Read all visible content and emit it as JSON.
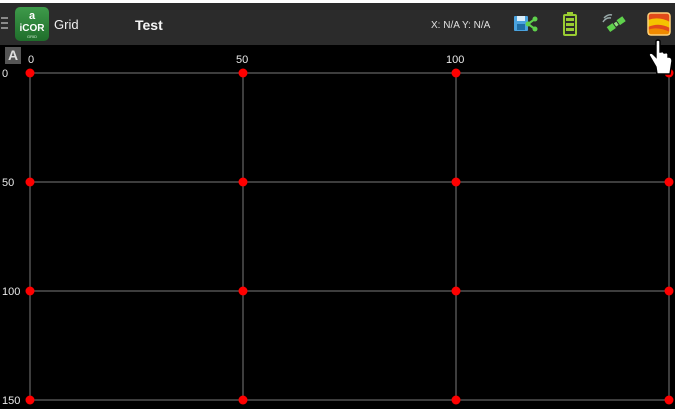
{
  "toolbar": {
    "menu_icon": "hamburger-menu-icon",
    "logo": {
      "mark": "a",
      "brand": "iCOR",
      "sub": "GRID"
    },
    "app_title": "Grid",
    "document_title": "Test",
    "coords_readout": "X: N/A Y: N/A",
    "icons": [
      "save-network-icon",
      "battery-icon",
      "satellite-icon",
      "heatmap-icon"
    ]
  },
  "grid": {
    "corner_label": "A",
    "x_ticks": [
      "0",
      "50",
      "100"
    ],
    "y_ticks": [
      "0",
      "50",
      "100",
      "150"
    ],
    "x_values": [
      0,
      50,
      100,
      150
    ],
    "y_values": [
      0,
      50,
      100,
      150
    ],
    "line_color": "#7a7a7a",
    "point_color": "#ff0000"
  }
}
